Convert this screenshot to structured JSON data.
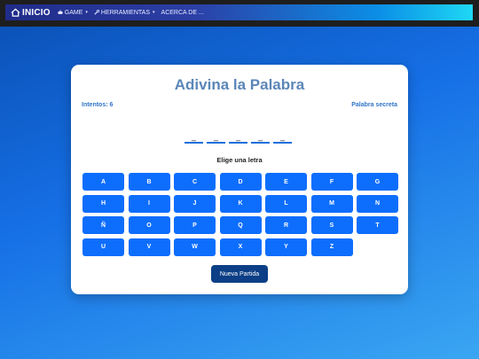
{
  "navbar": {
    "brand": "INICIO",
    "items": [
      {
        "label": "GAME",
        "icon": "gamepad-icon",
        "caret": "▾"
      },
      {
        "label": "HERRAMIENTAS",
        "icon": "wrench-icon",
        "caret": "▾"
      },
      {
        "label": "ACERCA DE ..."
      }
    ]
  },
  "game": {
    "title": "Adivina la Palabra",
    "attempts_label": "Intentos: 6",
    "secret_label": "Palabra secreta",
    "slots": [
      "_",
      "_",
      "_",
      "_",
      "_"
    ],
    "choose_label": "Elige una letra",
    "letters": [
      "A",
      "B",
      "C",
      "D",
      "E",
      "F",
      "G",
      "H",
      "I",
      "J",
      "K",
      "L",
      "M",
      "N",
      "Ñ",
      "O",
      "P",
      "Q",
      "R",
      "S",
      "T",
      "U",
      "V",
      "W",
      "X",
      "Y",
      "Z"
    ],
    "new_game_label": "Nueva Partida"
  },
  "colors": {
    "key": "#0d6efd",
    "new_game": "#0c3f86",
    "title": "#5b86b8",
    "labels": "#2f73c9"
  }
}
